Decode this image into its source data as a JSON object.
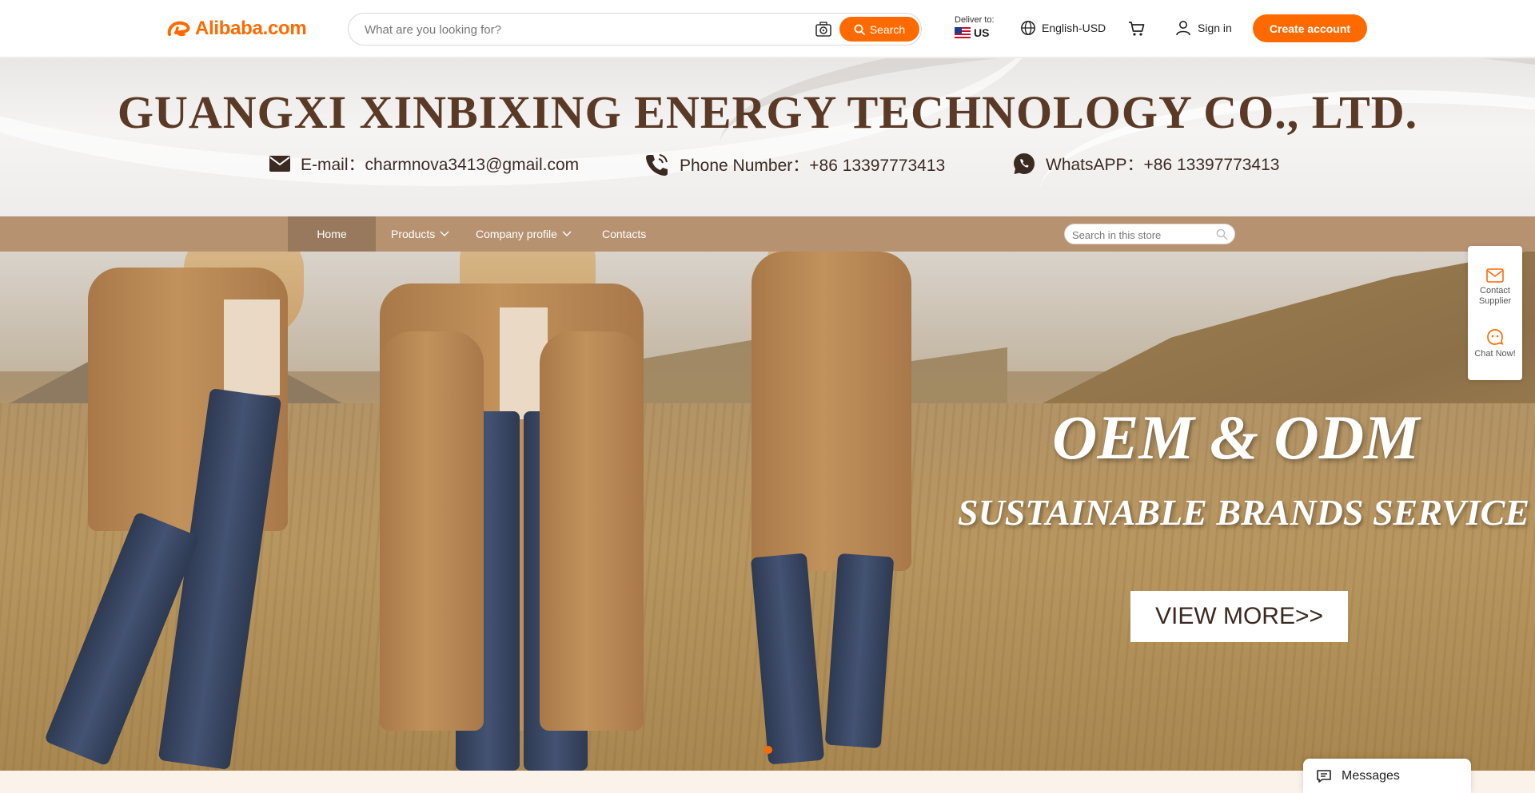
{
  "header": {
    "logo_text": "Alibaba.com",
    "search_placeholder": "What are you looking for?",
    "search_button": "Search",
    "deliver_label": "Deliver to:",
    "deliver_country": "US",
    "language": "English-USD",
    "sign_in": "Sign in",
    "create_account": "Create account",
    "brand_color": "#ff6a00"
  },
  "store": {
    "company_name": "GUANGXI XINBIXING ENERGY TECHNOLOGY CO., LTD.",
    "email_label": "E-mail：",
    "email": "charmnova3413@gmail.com",
    "phone_label": "Phone Number：",
    "phone": "+86 13397773413",
    "whatsapp_label": "WhatsAPP：",
    "whatsapp": "+86 13397773413"
  },
  "nav": {
    "items": [
      {
        "label": "Home",
        "active": true
      },
      {
        "label": "Products",
        "dropdown": true
      },
      {
        "label": "Company profile",
        "dropdown": true
      },
      {
        "label": "Contacts"
      }
    ],
    "store_search_placeholder": "Search in this store",
    "bar_color": "#b69271"
  },
  "hero": {
    "title": "OEM & ODM",
    "subtitle": "SUSTAINABLE BRANDS SERVICE",
    "cta": "VIEW MORE>>"
  },
  "side_panel": {
    "contact_supplier": [
      "Contact",
      "Supplier"
    ],
    "chat_now": "Chat Now!"
  },
  "messages": {
    "label": "Messages"
  }
}
